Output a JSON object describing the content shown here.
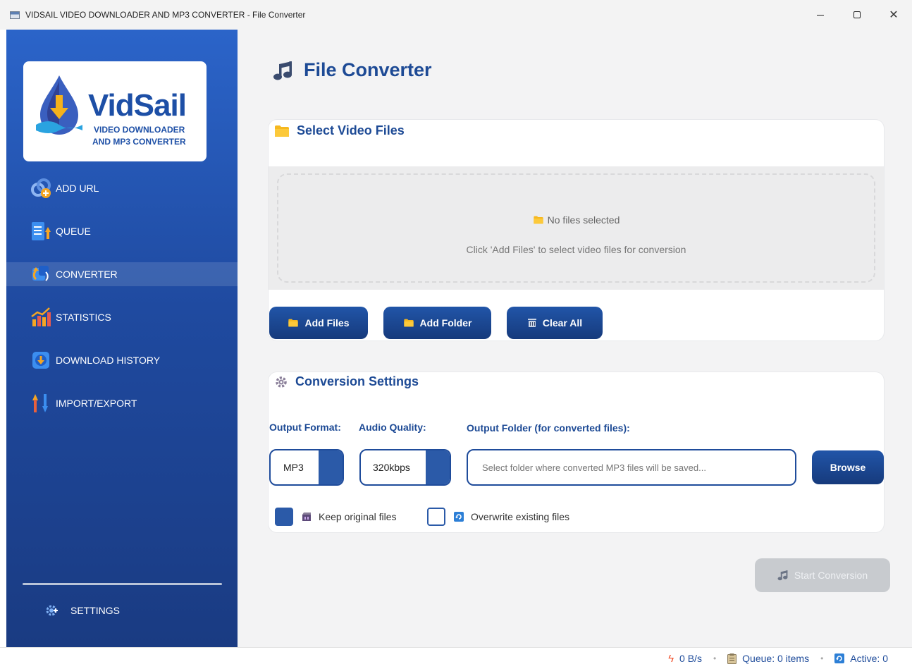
{
  "window": {
    "title": "VIDSAIL VIDEO DOWNLOADER AND MP3 CONVERTER - File Converter",
    "controls": [
      "minimize",
      "maximize",
      "close"
    ]
  },
  "logo": {
    "name": "VidSail",
    "line1": "VIDEO DOWNLOADER",
    "line2": "AND MP3 CONVERTER"
  },
  "sidebar": {
    "items": [
      {
        "label": "ADD URL",
        "icon": "link-icon",
        "active": false
      },
      {
        "label": "QUEUE",
        "icon": "queue-icon",
        "active": false
      },
      {
        "label": "CONVERTER",
        "icon": "converter-icon",
        "active": true
      },
      {
        "label": "STATISTICS",
        "icon": "chart-icon",
        "active": false
      },
      {
        "label": "DOWNLOAD HISTORY",
        "icon": "history-icon",
        "active": false
      },
      {
        "label": "IMPORT/EXPORT",
        "icon": "import-export-icon",
        "active": false
      }
    ],
    "settings_label": "SETTINGS"
  },
  "main": {
    "title": "File Converter",
    "files_section": {
      "header": "Select Video Files",
      "empty_title": "No files selected",
      "empty_hint": "Click 'Add Files' to select video files for conversion",
      "buttons": {
        "add_files": "Add Files",
        "add_folder": "Add Folder",
        "clear_all": "Clear All"
      }
    },
    "settings_section": {
      "header": "Conversion Settings",
      "output_format_label": "Output Format:",
      "output_format_value": "MP3",
      "audio_quality_label": "Audio Quality:",
      "audio_quality_value": "320kbps",
      "output_folder_label": "Output Folder (for converted files):",
      "output_folder_placeholder": "Select folder where converted MP3 files will be saved...",
      "browse_label": "Browse",
      "keep_original_label": "Keep original files",
      "keep_original_checked": true,
      "overwrite_label": "Overwrite existing files",
      "overwrite_checked": false
    },
    "start_label": "Start Conversion"
  },
  "statusbar": {
    "speed": "0 B/s",
    "queue": "Queue: 0 items",
    "active": "Active: 0"
  },
  "colors": {
    "accent": "#1d4a95",
    "sidebar_top": "#2b64c9",
    "sidebar_bottom": "#1a3b82",
    "disabled": "#c8cbcf"
  }
}
